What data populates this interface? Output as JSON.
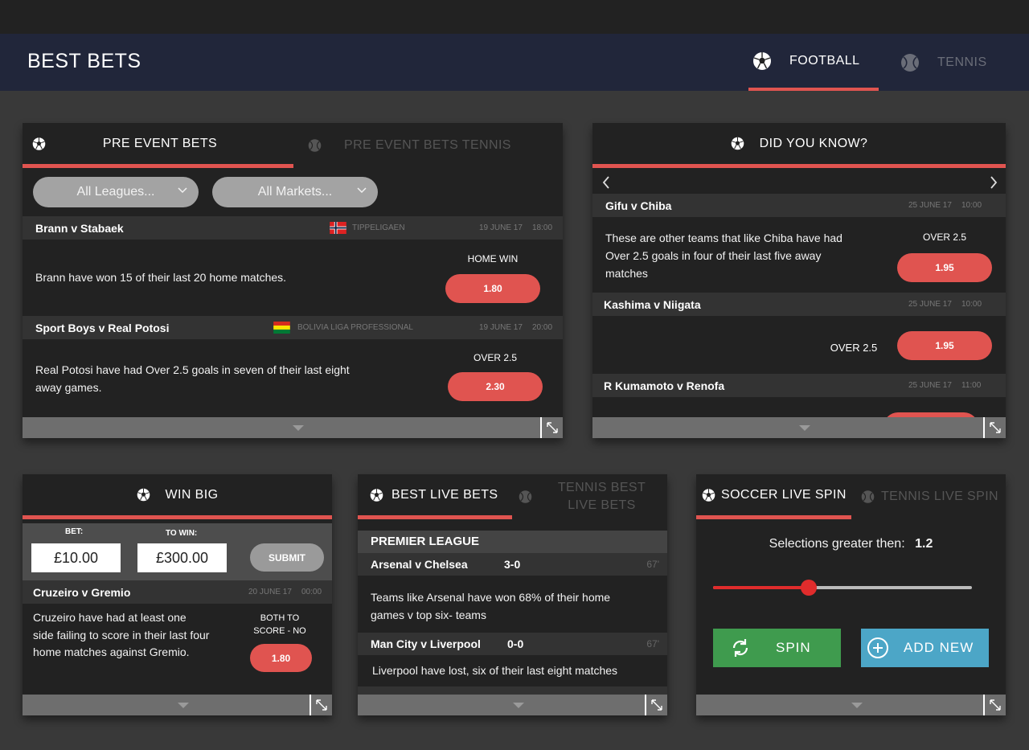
{
  "app": {
    "title": "BEST BETS"
  },
  "sport_tabs": [
    {
      "label": "FOOTBALL",
      "active": true,
      "icon": "soccer-ball-icon"
    },
    {
      "label": "TENNIS",
      "active": false,
      "icon": "tennis-ball-icon"
    }
  ],
  "pre_event": {
    "tabs": [
      "PRE EVENT BETS",
      "PRE EVENT BETS TENNIS"
    ],
    "filters": [
      "All Leagues...",
      "All Markets..."
    ],
    "matches": [
      {
        "name": "Brann v Stabaek",
        "league": "TIPPELIGAEN",
        "date": "19 JUNE 17",
        "time": "18:00",
        "text": "Brann have won 15 of their last 20 home matches.",
        "market": "HOME WIN",
        "odds": "1.80"
      },
      {
        "name": "Sport Boys v Real Potosi",
        "league": "BOLIVIA LIGA PROFESSIONAL",
        "date": "19 JUNE 17",
        "time": "20:00",
        "text": "Real Potosi have had Over 2.5 goals in seven of their last eight away games.",
        "market": "OVER 2.5",
        "odds": "2.30"
      }
    ]
  },
  "did_you_know": {
    "title": "DID YOU KNOW?",
    "items": [
      {
        "name": "Gifu v Chiba",
        "date": "25 JUNE 17",
        "time": "10:00",
        "text": "These are other teams that like Chiba have had Over 2.5 goals in four of their last five away matches",
        "market": "OVER 2.5",
        "odds": "1.95"
      },
      {
        "name": "Kashima v Niigata",
        "date": "25 JUNE 17",
        "time": "10:00",
        "market": "OVER 2.5",
        "odds": "1.95"
      },
      {
        "name": "R Kumamoto v Renofa",
        "date": "25 JUNE 17",
        "time": "11:00"
      }
    ]
  },
  "win_big": {
    "title": "WIN BIG",
    "bet_label": "BET:",
    "to_win_label": "TO WIN:",
    "bet_value": "£10.00",
    "to_win_value": "£300.00",
    "submit_label": "SUBMIT",
    "match": {
      "name": "Cruzeiro v Gremio",
      "date": "20 JUNE 17",
      "time": "00:00",
      "text": "Cruzeiro have had at least one side failing to score in their last four home matches against Gremio.",
      "market_line1": "BOTH TO",
      "market_line2": "SCORE - NO",
      "odds": "1.80"
    }
  },
  "live_bets": {
    "tabs": [
      "BEST LIVE BETS",
      "TENNIS BEST LIVE BETS"
    ],
    "league": "PREMIER LEAGUE",
    "matches": [
      {
        "name": "Arsenal v Chelsea",
        "score": "3-0",
        "minute": "67'",
        "text": "Teams like Arsenal have won 68% of their home games v top six- teams"
      },
      {
        "name": "Man City v Liverpool",
        "score": "0-0",
        "minute": "67'",
        "text": "Liverpool have lost, six of their last eight matches"
      }
    ]
  },
  "live_spin": {
    "tabs": [
      "SOCCER LIVE SPIN",
      "TENNIS LIVE SPIN"
    ],
    "selection_label": "Selections greater then:",
    "selection_value": "1.2",
    "slider_fraction": 0.37,
    "spin_label": "SPIN",
    "add_label": "ADD NEW"
  },
  "colors": {
    "accent": "#e05450",
    "header": "#21263a",
    "panel": "#222222",
    "spin": "#3f9b4e",
    "add": "#4ca6c7"
  }
}
